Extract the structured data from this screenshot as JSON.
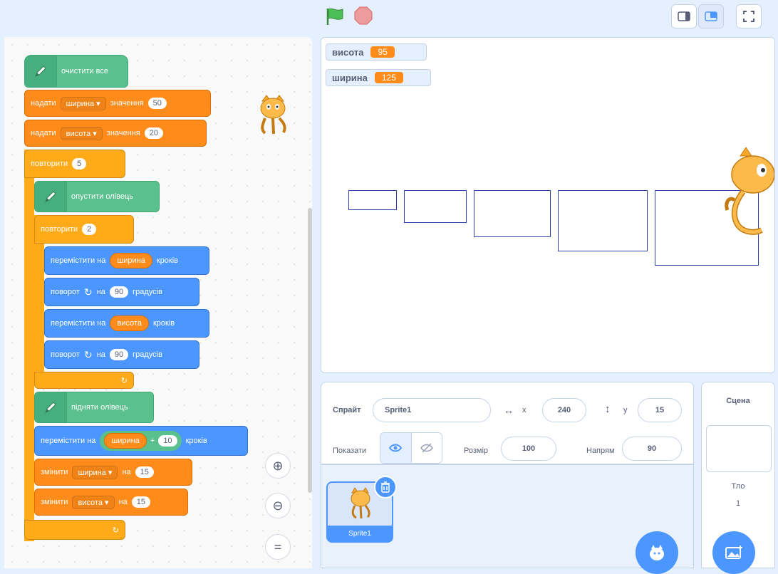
{
  "toolbar": {
    "flag_icon": "green-flag-icon",
    "stop_icon": "stop-icon",
    "mode_icons": [
      "small-stage-icon",
      "normal-stage-icon",
      "fullscreen-icon"
    ]
  },
  "code": {
    "pen_clear": "очистити все",
    "set1": {
      "label": "надати",
      "var": "ширина ▾",
      "to": "значення",
      "value": "50"
    },
    "set2": {
      "label": "надати",
      "var": "висота ▾",
      "to": "значення",
      "value": "20"
    },
    "repeat_outer": {
      "label": "повторити",
      "count": "5"
    },
    "pen_down": "опустити олівець",
    "repeat_inner": {
      "label": "повторити",
      "count": "2"
    },
    "move1": {
      "label": "перемістити на",
      "reporter": "ширина",
      "suffix": "кроків"
    },
    "turn1": {
      "label": "поворот",
      "on": "на",
      "value": "90",
      "suffix": "градусів"
    },
    "move2": {
      "label": "перемістити на",
      "reporter": "висота",
      "suffix": "кроків"
    },
    "turn2": {
      "label": "поворот",
      "on": "на",
      "value": "90",
      "suffix": "градусів"
    },
    "pen_up": "підняти олівець",
    "move3": {
      "label": "перемістити на",
      "reporter": "ширина",
      "op": "+",
      "value": "10",
      "suffix": "кроків"
    },
    "change1": {
      "label": "змінити",
      "var": "ширина ▾",
      "by": "на",
      "value": "15"
    },
    "change2": {
      "label": "змінити",
      "var": "висота ▾",
      "by": "на",
      "value": "15"
    },
    "arrow": "↻",
    "zoom_in": "⊕",
    "zoom_out": "⊖",
    "zoom_reset": "="
  },
  "stage": {
    "monitors": [
      {
        "name": "висота",
        "value": "95"
      },
      {
        "name": "ширина",
        "value": "125"
      }
    ]
  },
  "sprite_info": {
    "sprite_label": "Спрайт",
    "sprite_name": "Sprite1",
    "x_label": "x",
    "x_value": "240",
    "y_label": "y",
    "y_value": "15",
    "show_label": "Показати",
    "size_label": "Розмір",
    "size_value": "100",
    "direction_label": "Напрям",
    "direction_value": "90"
  },
  "sprite_list": {
    "items": [
      {
        "name": "Sprite1"
      }
    ]
  },
  "stage_panel": {
    "title": "Сцена",
    "backdrop_label": "Тло",
    "backdrop_count": "1"
  },
  "colors": {
    "pen": "#59c08e",
    "variables": "#ff8c1a",
    "control": "#ffab19",
    "motion": "#4c97ff",
    "stage_bg": "#e5f0ff",
    "drawn_rect": "#2d43a8"
  }
}
